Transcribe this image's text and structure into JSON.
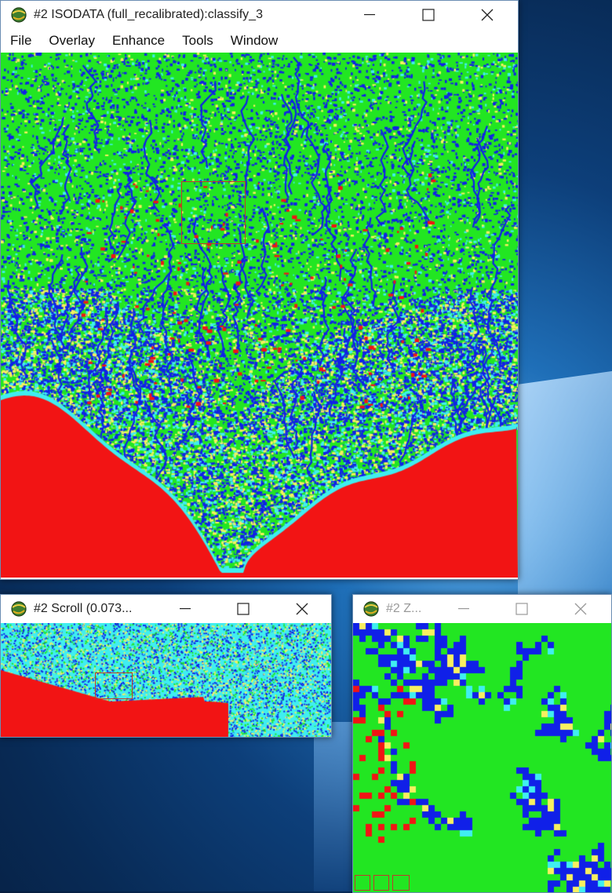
{
  "main_window": {
    "title": "#2 ISODATA (full_recalibrated):classify_3",
    "menu": [
      "File",
      "Overlay",
      "Enhance",
      "Tools",
      "Window"
    ]
  },
  "scroll_window": {
    "title": "#2 Scroll (0.073..."
  },
  "zoom_window": {
    "title": "#2 Z..."
  },
  "window_controls": {
    "minimize": "minimize",
    "maximize": "maximize",
    "close": "close"
  },
  "classes": {
    "vegetation": "#22e622",
    "water_dense": "#1020e8",
    "sea": "#f21414",
    "shallow": "#40eef0",
    "sand": "#f8f060"
  }
}
